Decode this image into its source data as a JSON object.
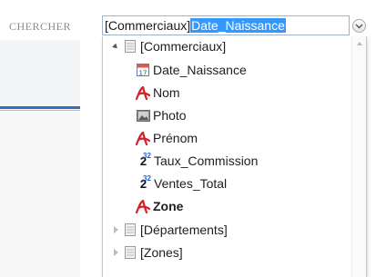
{
  "search": {
    "label": "CHERCHER",
    "prefix": "[Commerciaux]",
    "selected": "Date_Naissance"
  },
  "tree": {
    "root": {
      "label": "[Commerciaux]",
      "expanded": true
    },
    "fields": [
      {
        "label": "Date_Naissance",
        "icon": "calendar-icon",
        "bold": false
      },
      {
        "label": "Nom",
        "icon": "text-field-icon",
        "bold": false
      },
      {
        "label": "Photo",
        "icon": "picture-icon",
        "bold": false
      },
      {
        "label": "Prénom",
        "icon": "text-field-icon",
        "bold": false
      },
      {
        "label": "Taux_Commission",
        "icon": "number-icon",
        "bold": false
      },
      {
        "label": "Ventes_Total",
        "icon": "number-icon",
        "bold": false
      },
      {
        "label": "Zone",
        "icon": "text-field-icon",
        "bold": true
      }
    ],
    "siblings": [
      {
        "label": "[Départements]",
        "expanded": false
      },
      {
        "label": "[Zones]",
        "expanded": false
      }
    ]
  },
  "icons": {
    "calendar_number": "17",
    "number_base": "2",
    "number_exp": "32"
  },
  "colors": {
    "selection": "#3399ff",
    "text_icon": "#d61f26",
    "accent": "#2f6fbe"
  }
}
